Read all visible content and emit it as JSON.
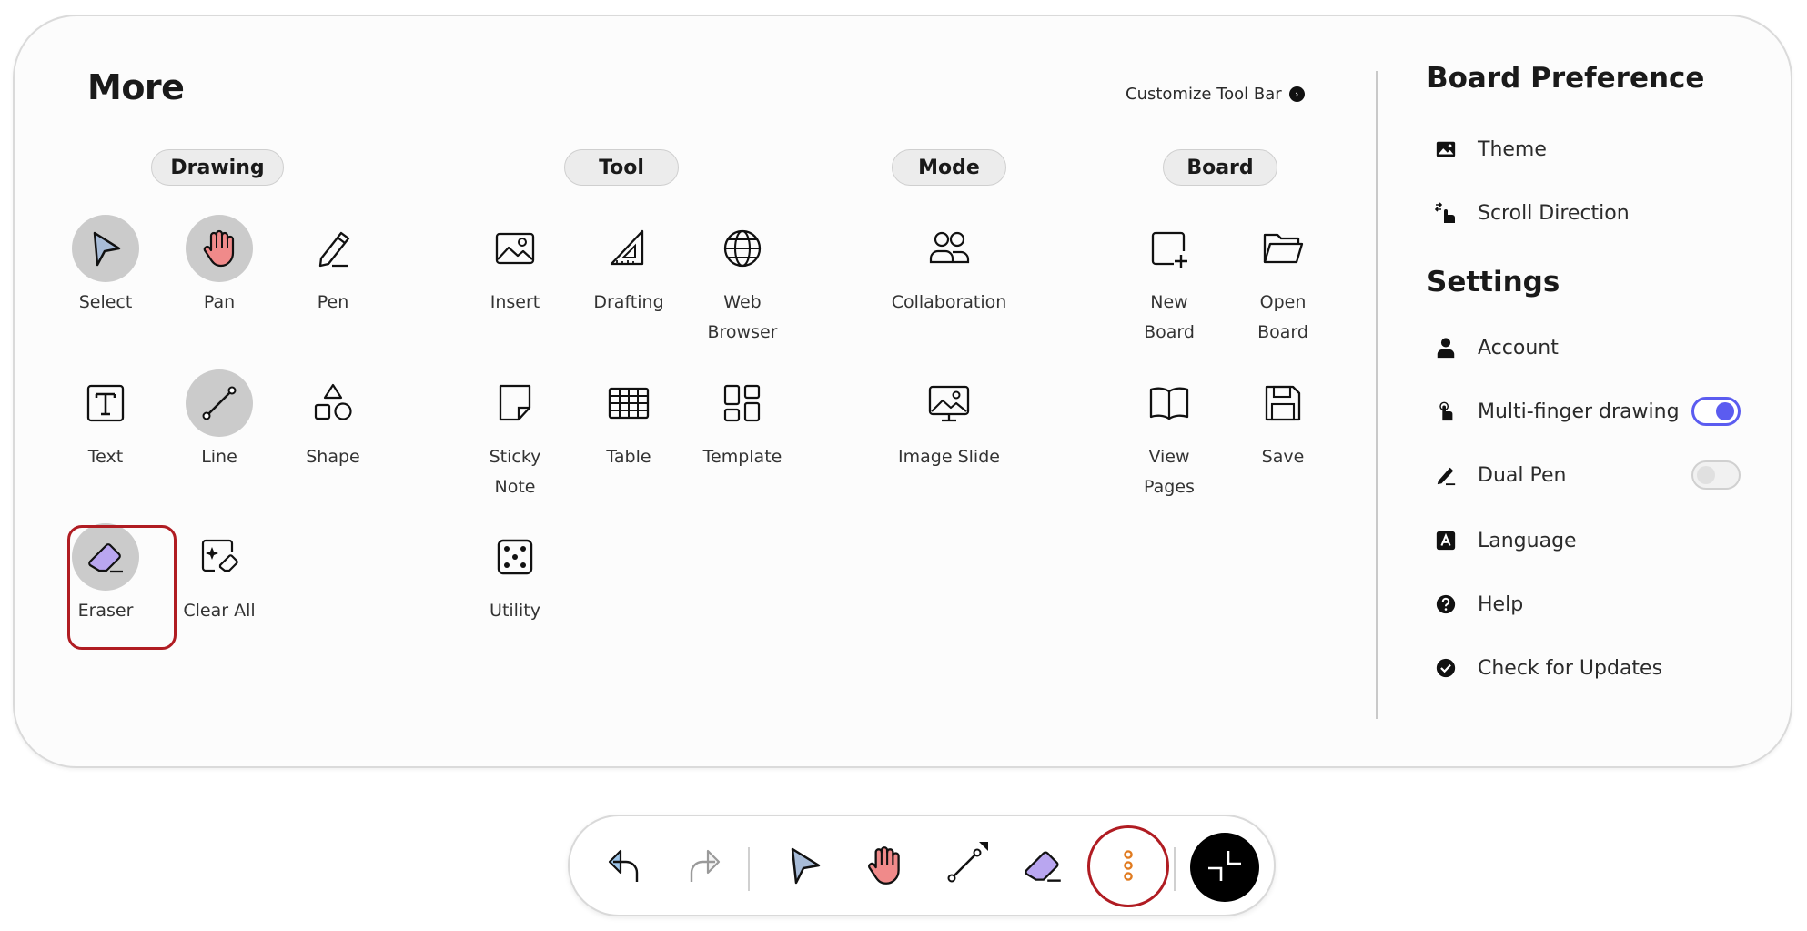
{
  "more_panel": {
    "title": "More",
    "customize_label": "Customize Tool Bar",
    "categories": {
      "drawing": "Drawing",
      "tool": "Tool",
      "mode": "Mode",
      "board": "Board"
    },
    "drawing_tools": {
      "select": "Select",
      "pan": "Pan",
      "pen": "Pen",
      "text": "Text",
      "line": "Line",
      "shape": "Shape",
      "eraser": "Eraser",
      "clear_all": "Clear All"
    },
    "tool_tools": {
      "insert": "Insert",
      "drafting": "Drafting",
      "web_browser": "Web\nBrowser",
      "sticky_note": "Sticky\nNote",
      "table": "Table",
      "template": "Template",
      "utility": "Utility"
    },
    "mode_tools": {
      "collaboration": "Collaboration",
      "image_slide": "Image Slide"
    },
    "board_tools": {
      "new_board": "New\nBoard",
      "open_board": "Open\nBoard",
      "view_pages": "View\nPages",
      "save": "Save"
    }
  },
  "board_preference": {
    "title": "Board Preference",
    "theme": "Theme",
    "scroll_direction": "Scroll Direction"
  },
  "settings": {
    "title": "Settings",
    "account": "Account",
    "multi_finger": "Multi-finger drawing",
    "multi_finger_on": true,
    "dual_pen": "Dual Pen",
    "dual_pen_on": false,
    "language": "Language",
    "help": "Help",
    "check_updates": "Check for Updates"
  },
  "colors": {
    "accent": "#5b5cf0",
    "highlight": "#b01c22",
    "select_fill": "#a8bcd8",
    "pan_fill": "#f08a8a",
    "eraser_fill": "#b9a6f0",
    "more_dots": "#e07b20"
  },
  "icons": [
    "undo-icon",
    "redo-icon",
    "select-arrow-icon",
    "pan-hand-icon",
    "line-icon",
    "eraser-icon",
    "more-vertical-icon",
    "collapse-icon"
  ]
}
